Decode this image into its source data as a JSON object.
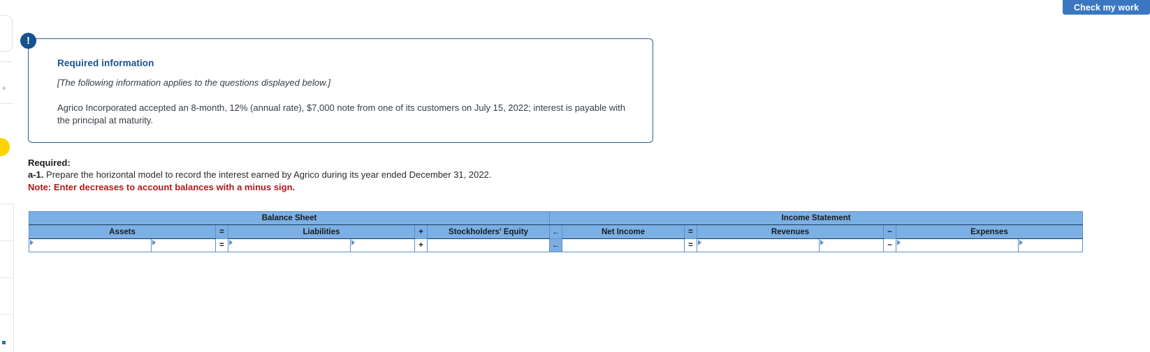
{
  "toolbar": {
    "check_my_work_label": "Check my work"
  },
  "info_panel": {
    "badge_glyph": "!",
    "title": "Required information",
    "applies_note": "[The following information applies to the questions displayed below.]",
    "body": "Agrico Incorporated accepted an 8-month, 12% (annual rate), $7,000 note from one of its customers on July 15, 2022; interest is payable with the principal at maturity."
  },
  "required": {
    "heading": "Required:",
    "item_label": "a-1.",
    "item_text": " Prepare the horizontal model to record the interest earned by Agrico during its year ended December 31, 2022.",
    "note": "Note: Enter decreases to account balances with a minus sign."
  },
  "horizontal_model": {
    "groups": [
      {
        "label": "Balance Sheet"
      },
      {
        "label": "Income Statement"
      }
    ],
    "columns": [
      {
        "label": "Assets",
        "type": "field"
      },
      {
        "label": "=",
        "type": "operator"
      },
      {
        "label": "Liabilities",
        "type": "field"
      },
      {
        "label": "+",
        "type": "operator"
      },
      {
        "label": "Stockholders' Equity",
        "type": "field"
      },
      {
        "label": "←",
        "type": "operator"
      },
      {
        "label": "Net Income",
        "type": "field"
      },
      {
        "label": "=",
        "type": "operator"
      },
      {
        "label": "Revenues",
        "type": "field"
      },
      {
        "label": "−",
        "type": "operator"
      },
      {
        "label": "Expenses",
        "type": "field"
      }
    ],
    "row_values": {
      "assets_account": "",
      "assets_amount": "",
      "op_eq_1": "=",
      "liabilities_account": "",
      "liabilities_amount": "",
      "op_plus": "+",
      "stockholders_equity": "",
      "op_arrow": "←",
      "net_income": "",
      "op_eq_2": "=",
      "revenues_account": "",
      "revenues_amount": "",
      "op_minus": "−",
      "expenses_account": "",
      "expenses_amount": ""
    },
    "placeholders": {
      "empty": ""
    }
  },
  "colors": {
    "header_blue": "#7cb0e4",
    "border_blue": "#5b8fc9",
    "panel_border": "#2b5d9b",
    "badge_navy": "#16528f",
    "note_red": "#b01b1b",
    "button_blue": "#3a77bf",
    "accent_yellow": "#ffd100"
  }
}
